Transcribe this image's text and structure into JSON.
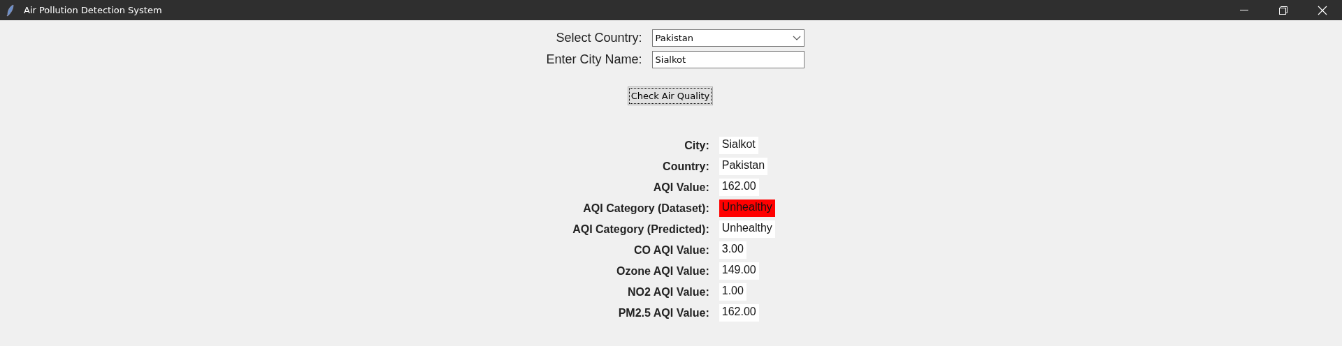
{
  "window": {
    "title": "Air Pollution Detection System"
  },
  "form": {
    "country_label": "Select Country:",
    "country_value": "Pakistan",
    "city_label": "Enter City Name:",
    "city_value": "Sialkot",
    "button": "Check Air Quality"
  },
  "results": [
    {
      "label": "City:",
      "value": "Sialkot",
      "color": "#ffffff"
    },
    {
      "label": "Country:",
      "value": "Pakistan",
      "color": "#ffffff"
    },
    {
      "label": "AQI Value:",
      "value": "162.00",
      "color": "#ffffff"
    },
    {
      "label": "AQI Category (Dataset):",
      "value": "Unhealthy",
      "color": "#ff0000"
    },
    {
      "label": "AQI Category (Predicted):",
      "value": "Unhealthy",
      "color": "#ffffff"
    },
    {
      "label": "CO AQI Value:",
      "value": "3.00",
      "color": "#ffffff"
    },
    {
      "label": "Ozone AQI Value:",
      "value": "149.00",
      "color": "#ffffff"
    },
    {
      "label": "NO2 AQI Value:",
      "value": "1.00",
      "color": "#ffffff"
    },
    {
      "label": "PM2.5 AQI Value:",
      "value": "162.00",
      "color": "#ffffff"
    }
  ]
}
